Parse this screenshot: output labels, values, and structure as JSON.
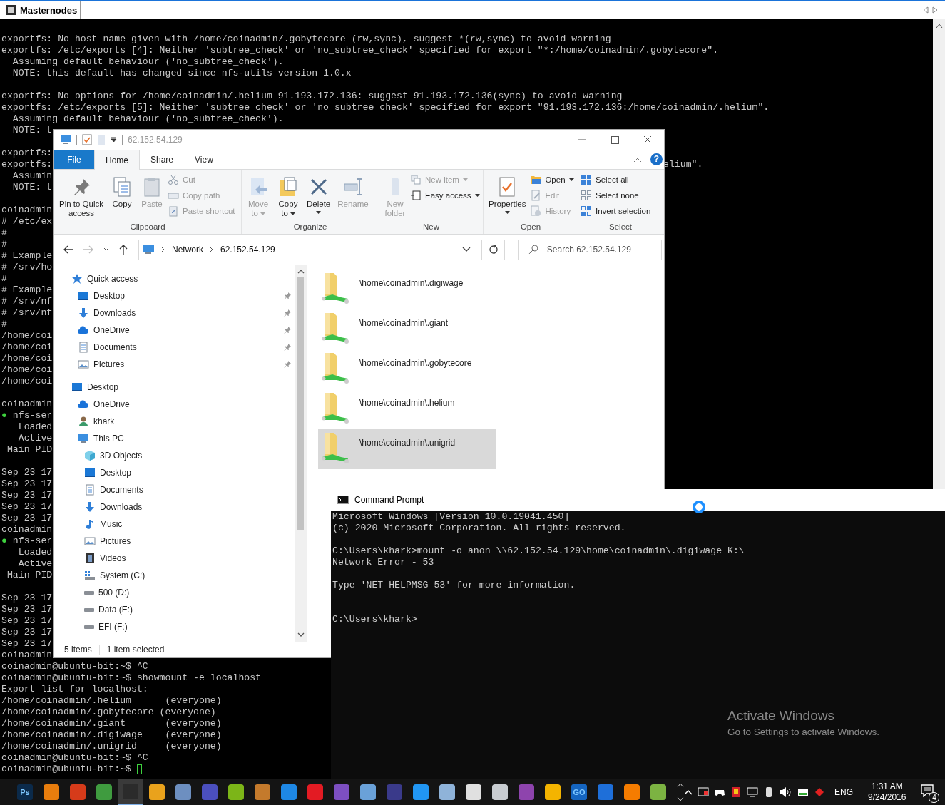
{
  "terminal": {
    "title": "Masternodes",
    "lines": [
      {
        "kind": "text",
        "text": "exportfs: No host name given with /home/coinadmin/.gobytecore (rw,sync), suggest *(rw,sync) to avoid warning"
      },
      {
        "kind": "text",
        "text": "exportfs: /etc/exports [4]: Neither 'subtree_check' or 'no_subtree_check' specified for export \"*:/home/coinadmin/.gobytecore\"."
      },
      {
        "kind": "text",
        "text": "  Assuming default behaviour ('no_subtree_check')."
      },
      {
        "kind": "text",
        "text": "  NOTE: this default has changed since nfs-utils version 1.0.x"
      },
      {
        "kind": "blank"
      },
      {
        "kind": "text",
        "text": "exportfs: No options for /home/coinadmin/.helium 91.193.172.136: suggest 91.193.172.136(sync) to avoid warning"
      },
      {
        "kind": "text",
        "text": "exportfs: /etc/exports [5]: Neither 'subtree_check' or 'no_subtree_check' specified for export \"91.193.172.136:/home/coinadmin/.helium\"."
      },
      {
        "kind": "text",
        "text": "  Assuming default behaviour ('no_subtree_check')."
      },
      {
        "kind": "text",
        "text": "  NOTE: t"
      },
      {
        "kind": "blank"
      },
      {
        "kind": "text",
        "text": "exportfs:"
      },
      {
        "kind": "text",
        "text": "exportfs:",
        "tail": "elium\"."
      },
      {
        "kind": "text",
        "text": "  Assumin"
      },
      {
        "kind": "text",
        "text": "  NOTE: t"
      },
      {
        "kind": "blank"
      },
      {
        "kind": "text",
        "text": "coinadmin"
      },
      {
        "kind": "text",
        "text": "# /etc/ex"
      },
      {
        "kind": "text",
        "text": "#"
      },
      {
        "kind": "text",
        "text": "#"
      },
      {
        "kind": "text",
        "text": "# Example"
      },
      {
        "kind": "text",
        "text": "# /srv/ho"
      },
      {
        "kind": "text",
        "text": "#"
      },
      {
        "kind": "text",
        "text": "# Example"
      },
      {
        "kind": "text",
        "text": "# /srv/nf"
      },
      {
        "kind": "text",
        "text": "# /srv/nf"
      },
      {
        "kind": "text",
        "text": "#"
      },
      {
        "kind": "text",
        "text": "/home/coi"
      },
      {
        "kind": "text",
        "text": "/home/coi"
      },
      {
        "kind": "text",
        "text": "/home/coi"
      },
      {
        "kind": "text",
        "text": "/home/coi"
      },
      {
        "kind": "text",
        "text": "/home/coi"
      },
      {
        "kind": "blank"
      },
      {
        "kind": "text",
        "text": "coinadmin"
      },
      {
        "kind": "status",
        "marker": "●",
        "text": " nfs-ser"
      },
      {
        "kind": "text",
        "text": "   Loaded"
      },
      {
        "kind": "text",
        "text": "   Active"
      },
      {
        "kind": "text",
        "text": " Main PID"
      },
      {
        "kind": "blank"
      },
      {
        "kind": "text",
        "text": "Sep 23 17"
      },
      {
        "kind": "text",
        "text": "Sep 23 17"
      },
      {
        "kind": "text",
        "text": "Sep 23 17"
      },
      {
        "kind": "text",
        "text": "Sep 23 17"
      },
      {
        "kind": "text",
        "text": "Sep 23 17"
      },
      {
        "kind": "text",
        "text": "coinadmin"
      },
      {
        "kind": "status",
        "marker": "●",
        "text": " nfs-ser"
      },
      {
        "kind": "text",
        "text": "   Loaded"
      },
      {
        "kind": "text",
        "text": "   Active"
      },
      {
        "kind": "text",
        "text": " Main PID"
      },
      {
        "kind": "blank"
      },
      {
        "kind": "text",
        "text": "Sep 23 17"
      },
      {
        "kind": "text",
        "text": "Sep 23 17"
      },
      {
        "kind": "text",
        "text": "Sep 23 17"
      },
      {
        "kind": "text",
        "text": "Sep 23 17"
      },
      {
        "kind": "text",
        "text": "Sep 23 17"
      },
      {
        "kind": "text",
        "text": "coinadmin"
      },
      {
        "kind": "text",
        "text": "coinadmin@ubuntu-bit:~$ ^C"
      },
      {
        "kind": "text",
        "text": "coinadmin@ubuntu-bit:~$ showmount -e localhost"
      },
      {
        "kind": "text",
        "text": "Export list for localhost:"
      },
      {
        "kind": "text",
        "text": "/home/coinadmin/.helium      (everyone)"
      },
      {
        "kind": "text",
        "text": "/home/coinadmin/.gobytecore (everyone)"
      },
      {
        "kind": "text",
        "text": "/home/coinadmin/.giant       (everyone)"
      },
      {
        "kind": "text",
        "text": "/home/coinadmin/.digiwage    (everyone)"
      },
      {
        "kind": "text",
        "text": "/home/coinadmin/.unigrid     (everyone)"
      },
      {
        "kind": "text",
        "text": "coinadmin@ubuntu-bit:~$ ^C"
      },
      {
        "kind": "prompt",
        "text": "coinadmin@ubuntu-bit:~$ "
      }
    ]
  },
  "explorer": {
    "title": "62.152.54.129",
    "help": "?",
    "tabs": [
      {
        "label": "File",
        "kind": "file",
        "selected": false
      },
      {
        "label": "Home",
        "kind": "tab",
        "selected": true
      },
      {
        "label": "Share",
        "kind": "tab",
        "selected": false
      },
      {
        "label": "View",
        "kind": "tab",
        "selected": false
      }
    ],
    "ribbon": [
      {
        "label": "Clipboard",
        "large": [
          {
            "kind": "pin",
            "label": "Pin to Quick\naccess",
            "disabled": false,
            "dropdown": false
          },
          {
            "kind": "copy",
            "label": "Copy",
            "disabled": false,
            "dropdown": false
          },
          {
            "kind": "paste",
            "label": "Paste",
            "disabled": true,
            "dropdown": false
          }
        ],
        "small": [
          {
            "kind": "cut",
            "label": "Cut",
            "disabled": true,
            "dropdown": false
          },
          {
            "kind": "copypath",
            "label": "Copy path",
            "disabled": true,
            "dropdown": false
          },
          {
            "kind": "pasteshortcut",
            "label": "Paste shortcut",
            "disabled": true,
            "dropdown": false
          }
        ]
      },
      {
        "label": "Organize",
        "large": [
          {
            "kind": "move",
            "label": "Move\nto",
            "disabled": true,
            "dropdown": true
          },
          {
            "kind": "copyto",
            "label": "Copy\nto",
            "disabled": false,
            "dropdown": true
          },
          {
            "kind": "delete",
            "label": "Delete",
            "disabled": false,
            "dropdown": true
          },
          {
            "kind": "rename",
            "label": "Rename",
            "disabled": true,
            "dropdown": false
          }
        ]
      },
      {
        "label": "New",
        "large": [
          {
            "kind": "newfolder",
            "label": "New\nfolder",
            "disabled": true,
            "dropdown": false
          }
        ],
        "small": [
          {
            "kind": "newitem",
            "label": "New item",
            "disabled": true,
            "dropdown": true
          },
          {
            "kind": "easyaccess",
            "label": "Easy access",
            "disabled": false,
            "dropdown": true
          }
        ]
      },
      {
        "label": "Open",
        "large": [
          {
            "kind": "properties",
            "label": "Properties",
            "disabled": false,
            "dropdown": true
          }
        ],
        "small": [
          {
            "kind": "open",
            "label": "Open",
            "disabled": false,
            "dropdown": true
          },
          {
            "kind": "edit",
            "label": "Edit",
            "disabled": true,
            "dropdown": false
          },
          {
            "kind": "history",
            "label": "History",
            "disabled": true,
            "dropdown": false
          }
        ]
      },
      {
        "label": "Select",
        "small": [
          {
            "kind": "selectall",
            "label": "Select all",
            "disabled": false,
            "dropdown": false
          },
          {
            "kind": "selectnone",
            "label": "Select none",
            "disabled": false,
            "dropdown": false
          },
          {
            "kind": "invert",
            "label": "Invert selection",
            "disabled": false,
            "dropdown": false
          }
        ]
      }
    ],
    "address": {
      "crumbs": [
        "Network",
        "62.152.54.129"
      ]
    },
    "search": {
      "placeholder": "Search 62.152.54.129"
    },
    "nav": [
      {
        "label": "Quick access",
        "kind": "star",
        "children": [
          {
            "label": "Desktop",
            "kind": "desktop",
            "pinned": true
          },
          {
            "label": "Downloads",
            "kind": "download",
            "pinned": true
          },
          {
            "label": "OneDrive",
            "kind": "cloud",
            "pinned": true
          },
          {
            "label": "Documents",
            "kind": "document",
            "pinned": true
          },
          {
            "label": "Pictures",
            "kind": "picture",
            "pinned": true
          }
        ]
      },
      {
        "label": "Desktop",
        "kind": "desktop",
        "children": [
          {
            "label": "OneDrive",
            "kind": "cloud"
          },
          {
            "label": "khark",
            "kind": "user"
          },
          {
            "label": "This PC",
            "kind": "pc",
            "children": [
              {
                "label": "3D Objects",
                "kind": "cube"
              },
              {
                "label": "Desktop",
                "kind": "desktop"
              },
              {
                "label": "Documents",
                "kind": "document"
              },
              {
                "label": "Downloads",
                "kind": "download"
              },
              {
                "label": "Music",
                "kind": "music"
              },
              {
                "label": "Pictures",
                "kind": "picture"
              },
              {
                "label": "Videos",
                "kind": "video"
              },
              {
                "label": "System (C:)",
                "kind": "sysdrive"
              },
              {
                "label": "500 (D:)",
                "kind": "drive"
              },
              {
                "label": "Data (E:)",
                "kind": "drive"
              },
              {
                "label": "EFI (F:)",
                "kind": "drive"
              }
            ]
          }
        ]
      }
    ],
    "items": [
      {
        "label": "\\home\\coinadmin\\.digiwage",
        "selected": false
      },
      {
        "label": "\\home\\coinadmin\\.giant",
        "selected": false
      },
      {
        "label": "\\home\\coinadmin\\.gobytecore",
        "selected": false
      },
      {
        "label": "\\home\\coinadmin\\.helium",
        "selected": false
      },
      {
        "label": "\\home\\coinadmin\\.unigrid",
        "selected": true
      }
    ],
    "status": {
      "count": "5 items",
      "selection": "1 item selected"
    }
  },
  "cmd": {
    "title": "Command Prompt",
    "lines": [
      {
        "kind": "text",
        "text": "Microsoft Windows [Version 10.0.19041.450]"
      },
      {
        "kind": "text",
        "text": "(c) 2020 Microsoft Corporation. All rights reserved."
      },
      {
        "kind": "blank"
      },
      {
        "kind": "text",
        "text": "C:\\Users\\khark>mount -o anon \\\\62.152.54.129\\home\\coinadmin\\.digiwage K:\\"
      },
      {
        "kind": "text",
        "text": "Network Error - 53"
      },
      {
        "kind": "blank"
      },
      {
        "kind": "text",
        "text": "Type 'NET HELPMSG 53' for more information."
      },
      {
        "kind": "blank"
      },
      {
        "kind": "blank"
      },
      {
        "kind": "text",
        "text": "C:\\Users\\khark>"
      }
    ],
    "watermark": {
      "title": "Activate Windows",
      "text": "Go to Settings to activate Windows."
    }
  },
  "taskbar": {
    "apps": [
      {
        "color": "#0b2a4a",
        "label": "Ps",
        "selected": false
      },
      {
        "color": "#e87d0d",
        "selected": false
      },
      {
        "color": "#d63b1a",
        "selected": false
      },
      {
        "color": "#3f9b3f",
        "selected": false
      },
      {
        "color": "#2b2b2b",
        "selected": true
      },
      {
        "color": "#e9a21c",
        "selected": false
      },
      {
        "color": "#6d8fc0",
        "selected": false
      },
      {
        "color": "#4b4fbf",
        "selected": false
      },
      {
        "color": "#7cb518",
        "selected": false
      },
      {
        "color": "#c47a2c",
        "selected": false
      },
      {
        "color": "#1e88e5",
        "selected": false
      },
      {
        "color": "#e31b23",
        "selected": false
      },
      {
        "color": "#7d4fc1",
        "selected": false
      },
      {
        "color": "#6aa1d8",
        "selected": false
      },
      {
        "color": "#3a3a8a",
        "selected": false
      },
      {
        "color": "#2196f3",
        "selected": false
      },
      {
        "color": "#8fb3d9",
        "selected": false
      },
      {
        "color": "#e0e0e0",
        "selected": false
      },
      {
        "color": "#c8ccd0",
        "selected": false
      },
      {
        "color": "#8e44ad",
        "selected": false
      },
      {
        "color": "#f4b400",
        "selected": false
      },
      {
        "color": "#1565c0",
        "label": "GO",
        "selected": false
      },
      {
        "color": "#1e6fd9",
        "selected": false
      },
      {
        "color": "#f57c00",
        "selected": false
      },
      {
        "color": "#7cb342",
        "selected": false
      }
    ],
    "language": "ENG",
    "time": "1:31 AM",
    "date": "9/24/2016",
    "notifications": "4"
  }
}
